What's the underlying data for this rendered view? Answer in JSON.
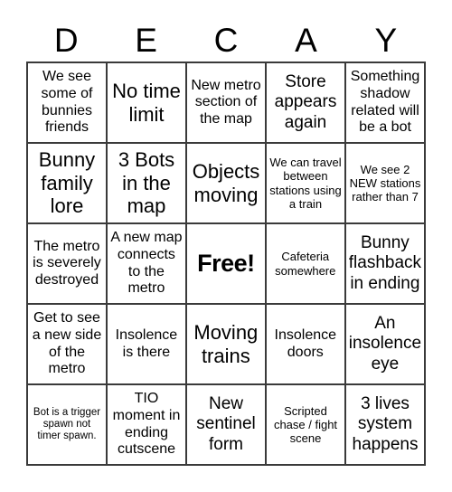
{
  "card": {
    "header_letters": [
      "D",
      "E",
      "C",
      "A",
      "Y"
    ],
    "colors": {
      "background": "#ffffff",
      "border": "#3a3a3a",
      "text": "#000000"
    },
    "grid": {
      "columns": 5,
      "rows": 5,
      "rows_data": [
        [
          {
            "text": "We see some of bunnies friends",
            "size": "md",
            "free": false
          },
          {
            "text": "No time limit",
            "size": "xl",
            "free": false
          },
          {
            "text": "New metro section of the map",
            "size": "md",
            "free": false
          },
          {
            "text": "Store appears again",
            "size": "lg",
            "free": false
          },
          {
            "text": "Something shadow related will be a bot",
            "size": "md",
            "free": false
          }
        ],
        [
          {
            "text": "Bunny family lore",
            "size": "xl",
            "free": false
          },
          {
            "text": "3 Bots in the map",
            "size": "xl",
            "free": false
          },
          {
            "text": "Objects moving",
            "size": "xl",
            "free": false
          },
          {
            "text": "We can travel between stations using a train",
            "size": "sm",
            "free": false
          },
          {
            "text": "We see 2 NEW stations rather than 7",
            "size": "sm",
            "free": false
          }
        ],
        [
          {
            "text": "The metro is severely destroyed",
            "size": "md",
            "free": false
          },
          {
            "text": "A new map connects to the metro",
            "size": "md",
            "free": false
          },
          {
            "text": "Free!",
            "size": "xl",
            "free": true
          },
          {
            "text": "Cafeteria somewhere",
            "size": "sm",
            "free": false
          },
          {
            "text": "Bunny flashback in ending",
            "size": "lg",
            "free": false
          }
        ],
        [
          {
            "text": "Get to see a new side of the metro",
            "size": "md",
            "free": false
          },
          {
            "text": "Insolence is there",
            "size": "md",
            "free": false
          },
          {
            "text": "Moving trains",
            "size": "xl",
            "free": false
          },
          {
            "text": "Insolence doors",
            "size": "md",
            "free": false
          },
          {
            "text": "An insolence eye",
            "size": "lg",
            "free": false
          }
        ],
        [
          {
            "text": "Bot is a trigger spawn not timer spawn.",
            "size": "xs",
            "free": false
          },
          {
            "text": "TIO moment in ending cutscene",
            "size": "md",
            "free": false
          },
          {
            "text": "New sentinel form",
            "size": "lg",
            "free": false
          },
          {
            "text": "Scripted chase / fight scene",
            "size": "sm",
            "free": false
          },
          {
            "text": "3 lives system happens",
            "size": "lg",
            "free": false
          }
        ]
      ]
    }
  }
}
